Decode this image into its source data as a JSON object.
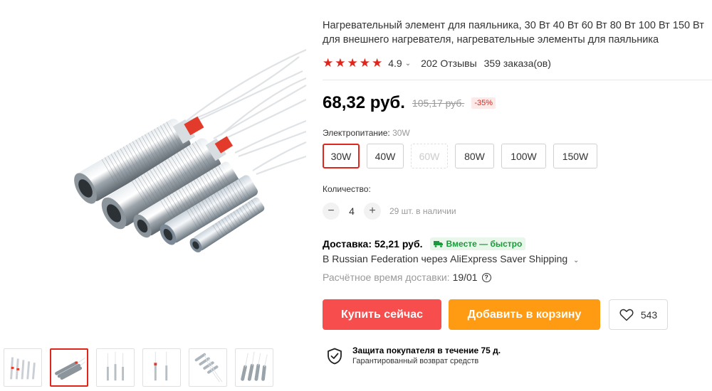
{
  "product": {
    "title": "Нагревательный элемент для паяльника, 30 Вт 40 Вт 60 Вт 80 Вт 100 Вт 150 Вт для внешнего нагревателя, нагревательные элементы для паяльника",
    "rating": "4.9",
    "reviews": "202 Отзывы",
    "orders": "359 заказа(ов)",
    "stars_filled": 5
  },
  "price": {
    "current": "68,32 руб.",
    "old": "105,17 руб.",
    "discount": "-35%"
  },
  "power": {
    "label": "Электропитание:",
    "selected_value": "30W",
    "options": [
      {
        "label": "30W",
        "state": "selected"
      },
      {
        "label": "40W",
        "state": "normal"
      },
      {
        "label": "60W",
        "state": "disabled"
      },
      {
        "label": "80W",
        "state": "normal"
      },
      {
        "label": "100W",
        "state": "normal"
      },
      {
        "label": "150W",
        "state": "normal"
      }
    ]
  },
  "quantity": {
    "label": "Количество:",
    "minus": "−",
    "value": "4",
    "plus": "+",
    "stock": "29 шт. в наличии"
  },
  "shipping": {
    "title": "Доставка: 52,21 руб.",
    "badge": "Вместе — быстро",
    "via": "В Russian Federation через AliExpress Saver Shipping",
    "time_label": "Расчётное время доставки:",
    "time_value": "19/01",
    "help": "?"
  },
  "actions": {
    "buy": "Купить сейчас",
    "cart": "Добавить в корзину",
    "wishlist_count": "543"
  },
  "protection": {
    "title": "Защита покупателя в течение 75 д.",
    "subtitle": "Гарантированный возврат средств"
  },
  "gallery": {
    "thumb_count": 6,
    "active_index": 1
  },
  "colors": {
    "accent_red": "#e1251b",
    "buy_button": "#f74d4d",
    "cart_button": "#ff9a13",
    "badge_green": "#1a9a3a"
  },
  "icons": [
    "star-icon",
    "chevron-down-icon",
    "help-icon",
    "heart-icon",
    "shield-check-icon",
    "truck-icon"
  ]
}
